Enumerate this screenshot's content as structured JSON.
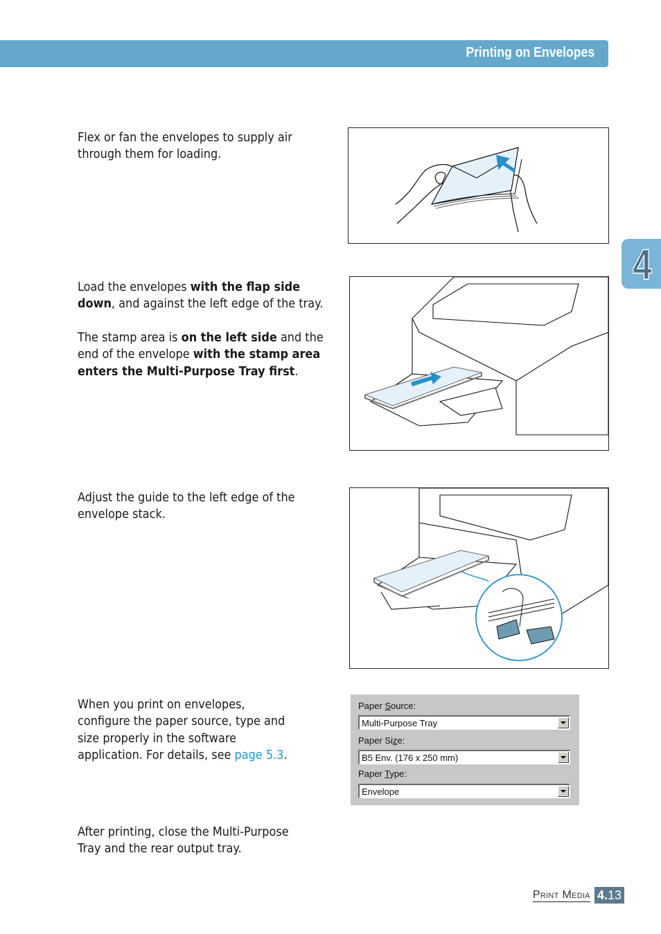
{
  "header": {
    "title": "Printing on Envelopes"
  },
  "chapter_tab": {
    "number": "4"
  },
  "steps": [
    {
      "text": "Flex or fan the envelopes to supply air through them for loading.",
      "figure": "fanning-envelopes-illustration"
    },
    {
      "parts": [
        {
          "t": "Load the envelopes ",
          "b": false
        },
        {
          "t": "with the flap side down",
          "b": true
        },
        {
          "t": ", and against the left edge of the tray.",
          "b": false
        }
      ],
      "parts2": [
        {
          "t": "The stamp area is ",
          "b": false
        },
        {
          "t": "on the left side",
          "b": true
        },
        {
          "t": " and the end of the envelope ",
          "b": false
        },
        {
          "t": "with the stamp area enters the Multi-Purpose Tray first",
          "b": true
        },
        {
          "t": ".",
          "b": false
        }
      ],
      "figure": "loading-envelopes-tray-illustration"
    },
    {
      "text": "Adjust the guide to the left edge of the envelope stack.",
      "figure": "adjust-paper-guide-illustration"
    },
    {
      "text_before": "When you print on envelopes, configure the paper source, type and size properly in the software application. For details, see ",
      "link": "page 5.3",
      "text_after": ".",
      "figure": "paper-settings-dialog"
    },
    {
      "text": "After printing, close the Multi-Purpose Tray and the rear output tray."
    }
  ],
  "dialog": {
    "source_label_pre": "Paper ",
    "source_label_u": "S",
    "source_label_post": "ource:",
    "source_value": "Multi-Purpose Tray",
    "size_label_pre": "Paper Si",
    "size_label_u": "z",
    "size_label_post": "e:",
    "size_value": "B5 Env. (176 x 250 mm)",
    "type_label_pre": "Paper ",
    "type_label_u": "T",
    "type_label_post": "ype:",
    "type_value": "Envelope"
  },
  "footer": {
    "section": "Print Media",
    "chapter": "4.",
    "page": "13"
  },
  "colors": {
    "header": "#64a8cc",
    "tab": "#7ab4d6",
    "link": "#1b9ad6",
    "footer_badge": "#5c7a8e",
    "illustration_blue": "#2a8fc8",
    "envelope_fill": "#e4f1fa"
  }
}
